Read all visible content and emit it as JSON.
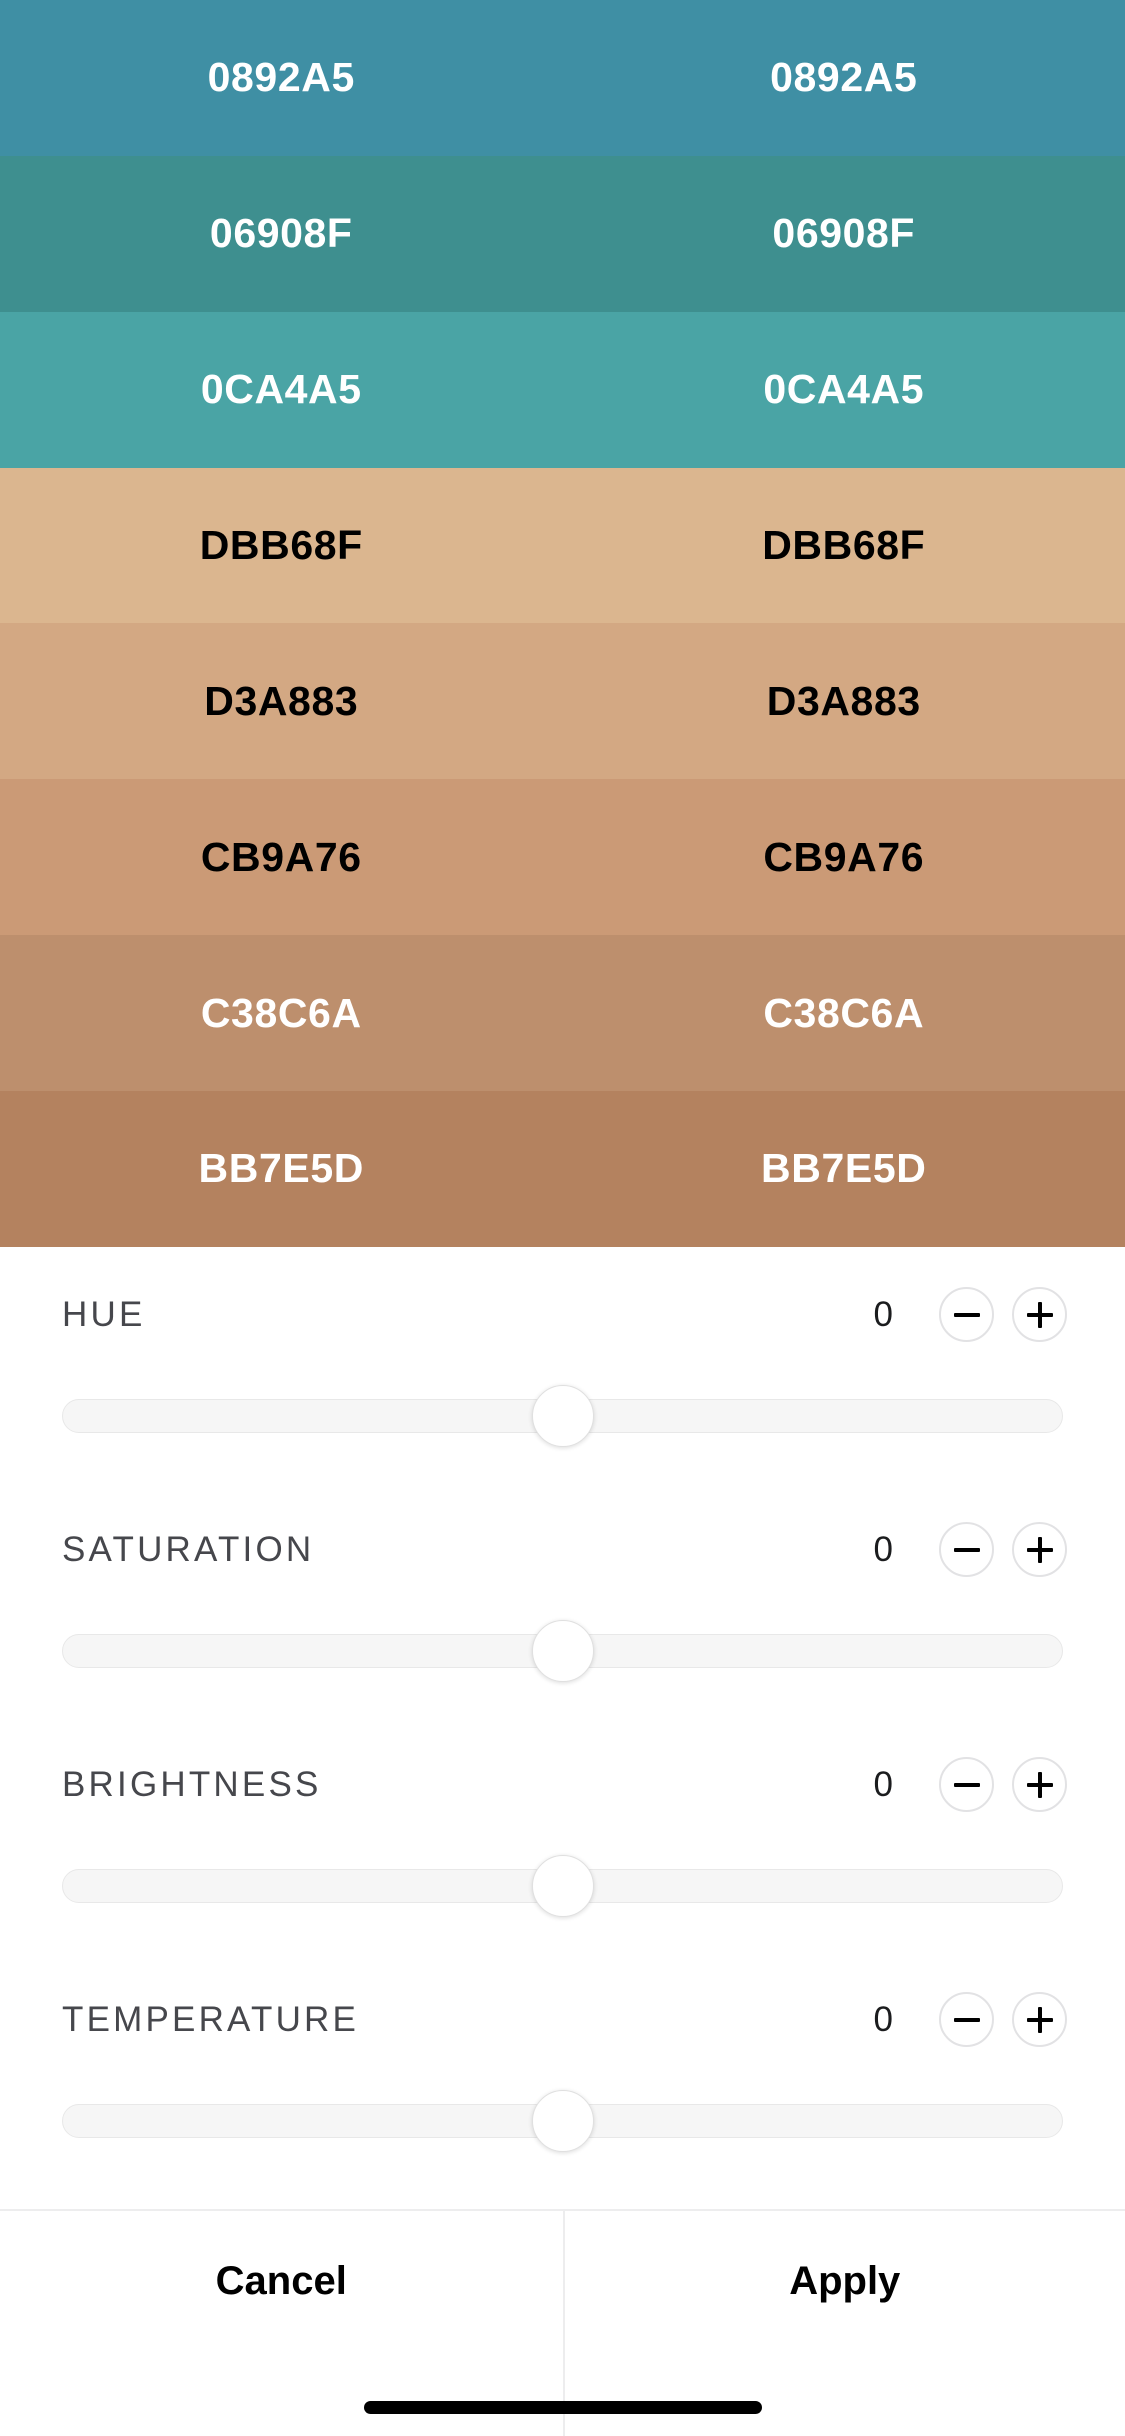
{
  "palette": {
    "swatches": [
      {
        "hex": "0892A5",
        "label": "0892A5",
        "bg": "#3f8fa4",
        "text": "#ffffff"
      },
      {
        "hex": "06908F",
        "label": "06908F",
        "bg": "#3e8f8f",
        "text": "#ffffff"
      },
      {
        "hex": "0CA4A5",
        "label": "0CA4A5",
        "bg": "#4aa4a5",
        "text": "#ffffff"
      },
      {
        "hex": "DBB68F",
        "label": "DBB68F",
        "bg": "#dbb68f",
        "text": "#000000"
      },
      {
        "hex": "D3A883",
        "label": "D3A883",
        "bg": "#d3a883",
        "text": "#000000"
      },
      {
        "hex": "CB9A76",
        "label": "CB9A76",
        "bg": "#cb9a76",
        "text": "#000000"
      },
      {
        "hex": "C38C6A",
        "label": "C38C6A",
        "bg": "#bd8f6d",
        "text": "#ffffff"
      },
      {
        "hex": "BB7E5D",
        "label": "BB7E5D",
        "bg": "#b4825f",
        "text": "#ffffff"
      }
    ]
  },
  "adjustments": {
    "decrement_icon": "minus-icon",
    "increment_icon": "plus-icon",
    "controls": [
      {
        "label": "HUE",
        "value": "0",
        "thumb_percent": 50
      },
      {
        "label": "SATURATION",
        "value": "0",
        "thumb_percent": 50
      },
      {
        "label": "BRIGHTNESS",
        "value": "0",
        "thumb_percent": 50
      },
      {
        "label": "TEMPERATURE",
        "value": "0",
        "thumb_percent": 50
      }
    ]
  },
  "actions": {
    "cancel_label": "Cancel",
    "apply_label": "Apply"
  }
}
